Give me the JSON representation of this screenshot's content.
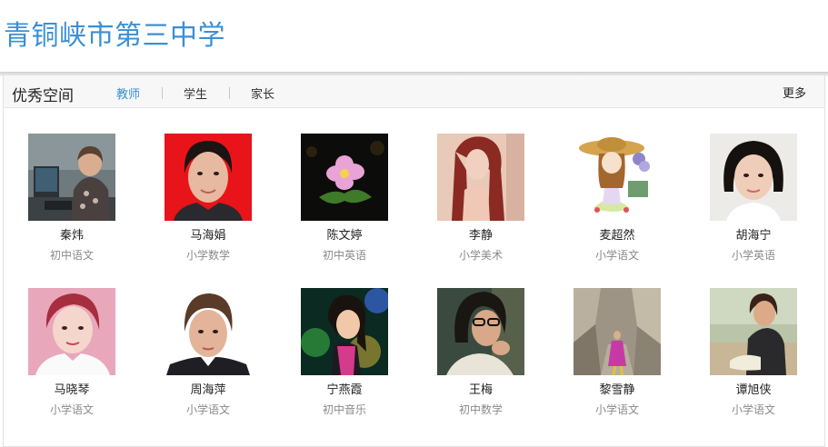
{
  "site": {
    "title": "青铜峡市第三中学"
  },
  "panel": {
    "title": "优秀空间",
    "tabs": [
      {
        "label": "教师",
        "active": true
      },
      {
        "label": "学生",
        "active": false
      },
      {
        "label": "家长",
        "active": false
      }
    ],
    "more_label": "更多"
  },
  "teachers": [
    {
      "name": "秦炜",
      "subject": "初中语文",
      "photo": "teacher-at-computer"
    },
    {
      "name": "马海娟",
      "subject": "小学数学",
      "photo": "portrait-red-background"
    },
    {
      "name": "陈文婷",
      "subject": "初中英语",
      "photo": "pink-flower"
    },
    {
      "name": "李静",
      "subject": "小学美术",
      "photo": "red-haired-woman-painting"
    },
    {
      "name": "麦超然",
      "subject": "小学语文",
      "photo": "cartoon-girl-with-hat"
    },
    {
      "name": "胡海宁",
      "subject": "小学英语",
      "photo": "short-hair-woman"
    },
    {
      "name": "马晓琴",
      "subject": "小学语文",
      "photo": "woman-pink-background"
    },
    {
      "name": "周海萍",
      "subject": "小学语文",
      "photo": "portrait-white-background"
    },
    {
      "name": "宁燕霞",
      "subject": "初中音乐",
      "photo": "woman-with-headphones"
    },
    {
      "name": "王梅",
      "subject": "初中数学",
      "photo": "woman-with-glasses"
    },
    {
      "name": "黎雪静",
      "subject": "小学语文",
      "photo": "canyon-scenery"
    },
    {
      "name": "谭旭侠",
      "subject": "小学语文",
      "photo": "woman-sitting-outdoors"
    }
  ]
}
